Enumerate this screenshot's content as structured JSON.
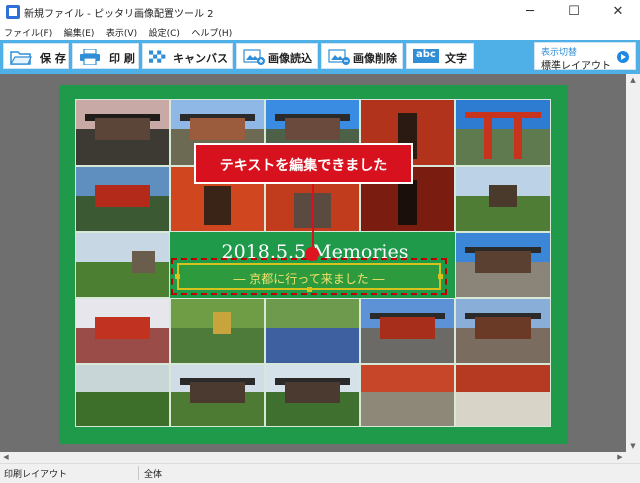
{
  "window": {
    "title": "新規ファイル - ピッタリ画像配置ツール 2",
    "minimize": "─",
    "maximize": "☐",
    "close": "✕"
  },
  "menu": [
    "ファイル(F)",
    "編集(E)",
    "表示(V)",
    "設定(C)",
    "ヘルプ(H)"
  ],
  "toolbar": {
    "save": "保 存",
    "print": "印 刷",
    "canvas": "キャンバス",
    "read_image": "画像読込",
    "delete_image": "画像削除",
    "text": "文字",
    "text_icon": "abc",
    "view_toggle_top": "表示切替",
    "view_toggle_bottom": "標準レイアウト"
  },
  "canvas": {
    "background_color": "#1f9a4a",
    "title_text": "2018.5.5 Memories",
    "caption_text": "― 京都に行って来ました ―"
  },
  "callout": {
    "text": "テキストを編集できました"
  },
  "status": {
    "left": "印刷レイアウト",
    "right": "全体"
  }
}
